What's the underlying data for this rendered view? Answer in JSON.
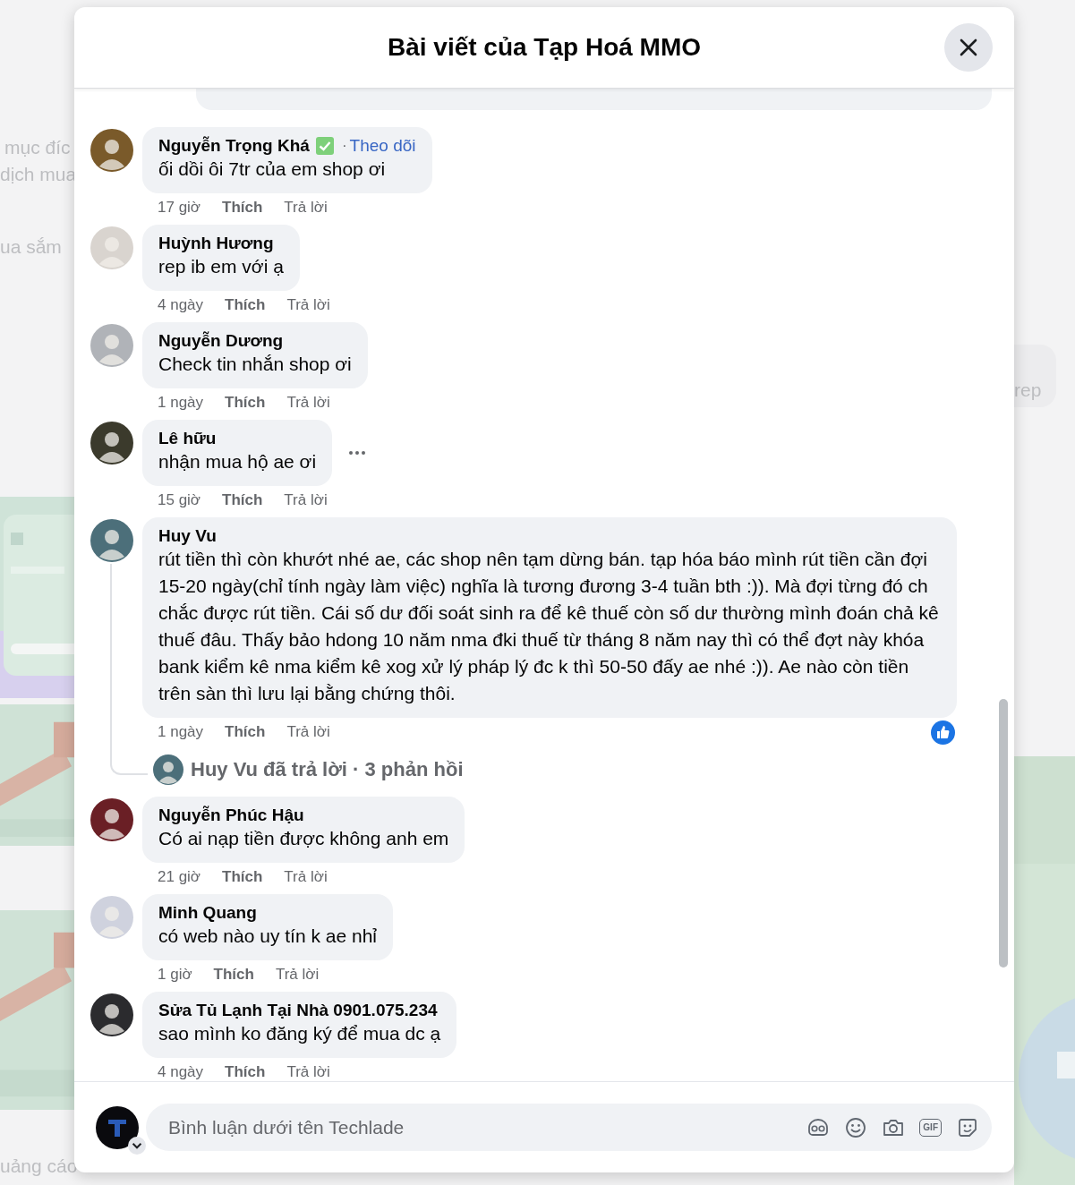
{
  "background": {
    "texts": [
      "mục đíc",
      "dịch mua",
      "ua sắm",
      "rep",
      "uảng cáo"
    ]
  },
  "dialog": {
    "title": "Bài viết của Tạp Hoá MMO"
  },
  "comments": [
    {
      "author": "Nguyễn Trọng Khá",
      "verified": true,
      "separator": "·",
      "follow": "Theo dõi",
      "text": "ối dồi ôi 7tr của em shop ơi",
      "time": "17 giờ",
      "like": "Thích",
      "reply": "Trả lời",
      "menu": false,
      "liked": false
    },
    {
      "author": "Huỳnh Hương",
      "verified": false,
      "text": "rep ib em với ạ",
      "time": "4 ngày",
      "like": "Thích",
      "reply": "Trả lời",
      "menu": false,
      "liked": false
    },
    {
      "author": "Nguyễn Dương",
      "verified": false,
      "text": "Check tin nhắn shop ơi",
      "time": "1 ngày",
      "like": "Thích",
      "reply": "Trả lời",
      "menu": false,
      "liked": false
    },
    {
      "author": "Lê hữu",
      "verified": false,
      "text": "nhận mua hộ ae ơi",
      "time": "15 giờ",
      "like": "Thích",
      "reply": "Trả lời",
      "menu": true,
      "liked": false
    },
    {
      "author": "Huy Vu",
      "verified": false,
      "text": "rút tiền thì còn khướt nhé ae, các shop nên tạm dừng bán. tạp hóa báo mình rút tiền cần đợi 15-20 ngày(chỉ tính ngày làm việc) nghĩa là tương đương 3-4 tuần bth :)). Mà đợi từng đó ch chắc được rút tiền. Cái số dư đối soát sinh ra để kê thuế còn số dư thường mình đoán chả kê thuế đâu. Thấy bảo hdong 10 năm nma đki thuế từ tháng 8 năm nay thì có thể đợt này khóa bank kiểm kê nma kiểm kê xog xử lý pháp lý đc k thì 50-50 đấy ae nhé :)). Ae nào còn tiền trên sàn thì lưu lại bằng chứng thôi.",
      "time": "1 ngày",
      "like": "Thích",
      "reply": "Trả lời",
      "menu": false,
      "liked": true,
      "replies": "Huy Vu đã trả lời · 3 phản hồi"
    },
    {
      "author": "Nguyễn Phúc Hậu",
      "verified": false,
      "text": "Có ai nạp tiền được không anh em",
      "time": "21 giờ",
      "like": "Thích",
      "reply": "Trả lời",
      "menu": false,
      "liked": false
    },
    {
      "author": "Minh Quang",
      "verified": false,
      "text": "có web nào uy tín k ae nhỉ",
      "time": "1 giờ",
      "like": "Thích",
      "reply": "Trả lời",
      "menu": false,
      "liked": false
    },
    {
      "author": "Sửa Tủ Lạnh Tại Nhà 0901.075.234",
      "verified": false,
      "text": "sao mình ko đăng ký để mua dc ạ",
      "time": "4 ngày",
      "like": "Thích",
      "reply": "Trả lời",
      "menu": false,
      "liked": false
    }
  ],
  "composer": {
    "placeholder": "Bình luận dưới tên Techlade",
    "gif_label": "GIF"
  }
}
